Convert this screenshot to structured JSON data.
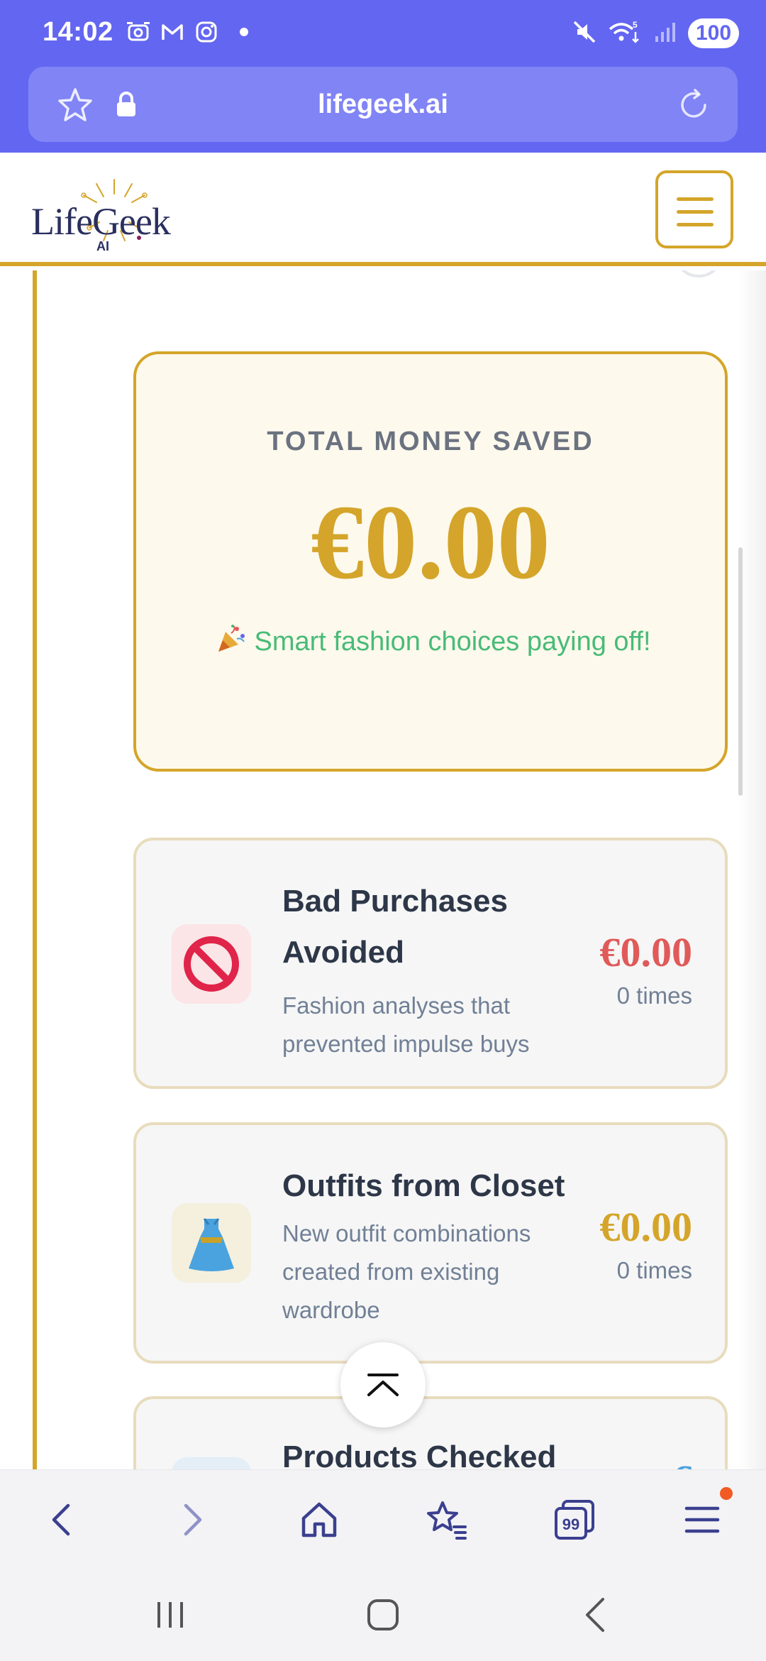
{
  "status_bar": {
    "time": "14:02",
    "battery": "100",
    "icons": [
      "screenshot-icon",
      "gmail-icon",
      "instagram-icon",
      "dot-icon",
      "mute-icon",
      "wifi-5g-icon",
      "signal-icon"
    ]
  },
  "browser": {
    "url": "lifegeek.ai"
  },
  "site": {
    "logo_text": "LifeGeek",
    "logo_sub": "AI",
    "colors": {
      "gold": "#d4a52a",
      "navy": "#2b2f5e",
      "green": "#48bb78",
      "red": "#e05a5a"
    }
  },
  "savings": {
    "label": "TOTAL MONEY SAVED",
    "value": "€0.00",
    "message": "Smart fashion choices paying off!"
  },
  "stats": [
    {
      "title": "Bad Purchases Avoided",
      "description": "Fashion analyses that prevented impulse buys",
      "amount": "€0.00",
      "times": "0 times",
      "icon": "prohibited-icon"
    },
    {
      "title": "Outfits from Closet",
      "description": "New outfit combinations created from existing wardrobe",
      "amount": "€0.00",
      "times": "0 times",
      "icon": "dress-icon"
    },
    {
      "title": "Products Checked",
      "amount": "€",
      "icon": "product-icon"
    }
  ]
}
